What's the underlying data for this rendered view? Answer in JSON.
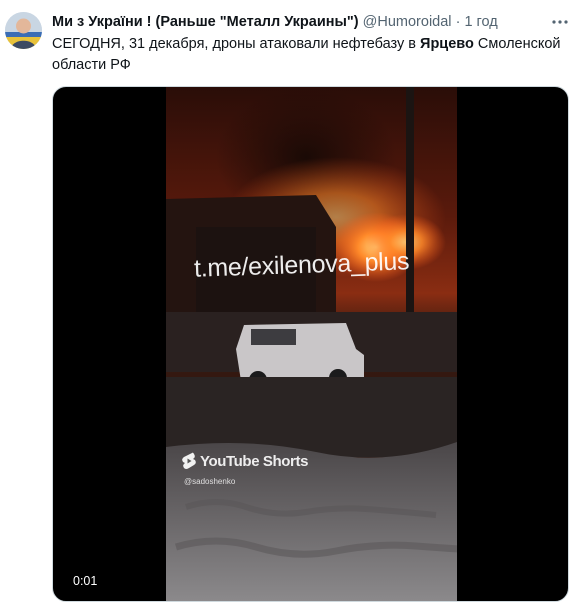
{
  "tweet": {
    "display_name": "Ми з України ! (Раньше \"Металл Украины\")",
    "handle": "@Humoroidal",
    "separator": "·",
    "time": "1 год",
    "more_icon": "more-horizontal-icon",
    "text": {
      "part1": "СЕГОДНЯ, 31 декабря, дроны атаковали нефтебазу в ",
      "bold": "Ярцево",
      "part2": " Смоленской области РФ"
    }
  },
  "video": {
    "watermark": "t.me/exilenova_plus",
    "shorts_label": "YouTube Shorts",
    "source_handle": "@sadoshenko",
    "timecode": "0:01",
    "shorts_icon": "youtube-shorts-icon"
  },
  "colors": {
    "text_primary": "#0f1419",
    "text_secondary": "#536471",
    "video_bg": "#000000"
  }
}
